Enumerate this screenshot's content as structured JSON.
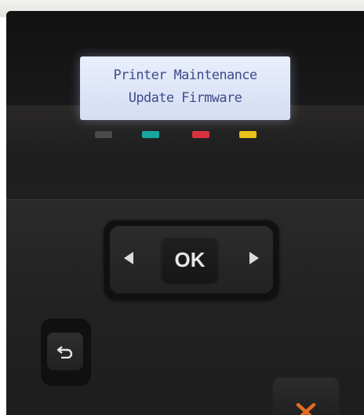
{
  "display": {
    "line1": "Printer Maintenance",
    "line2": "Update Firmware"
  },
  "ink_indicators": [
    {
      "name": "black",
      "color": "#4a4a4a"
    },
    {
      "name": "cyan",
      "color": "#18a7a0"
    },
    {
      "name": "magenta",
      "color": "#d8323e"
    },
    {
      "name": "yellow",
      "color": "#e8c21a"
    }
  ],
  "buttons": {
    "left_icon": "left-arrow-icon",
    "ok_label": "OK",
    "right_icon": "right-arrow-icon",
    "back_icon": "back-arrow-icon",
    "cancel_icon": "x-cancel-icon",
    "cancel_color": "#e86a1d"
  }
}
